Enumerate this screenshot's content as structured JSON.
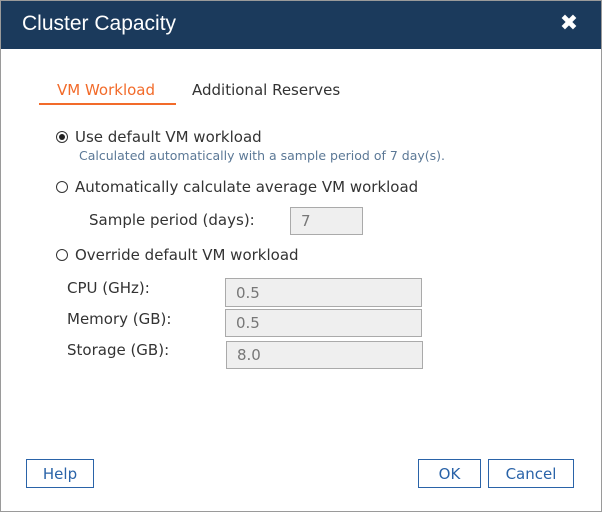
{
  "dialog": {
    "title": "Cluster Capacity",
    "close_icon": "close-icon"
  },
  "tabs": [
    {
      "label": "VM Workload",
      "active": true
    },
    {
      "label": "Additional Reserves",
      "active": false
    }
  ],
  "colors": {
    "titlebar": "#1b3a5c",
    "accent": "#f26b2a",
    "button": "#2a63a8"
  },
  "options": {
    "default": {
      "label": "Use default VM workload",
      "selected": true,
      "description": "Calculated automatically with a sample period of 7 day(s)."
    },
    "auto": {
      "label": "Automatically calculate average VM workload",
      "selected": false,
      "sample_label": "Sample period (days):",
      "sample_value": "7"
    },
    "override": {
      "label": "Override default VM workload",
      "selected": false,
      "cpu_label": "CPU (GHz):",
      "cpu_value": "0.5",
      "memory_label": "Memory (GB):",
      "memory_value": "0.5",
      "storage_label": "Storage (GB):",
      "storage_value": "8.0"
    }
  },
  "buttons": {
    "help": "Help",
    "ok": "OK",
    "cancel": "Cancel"
  }
}
